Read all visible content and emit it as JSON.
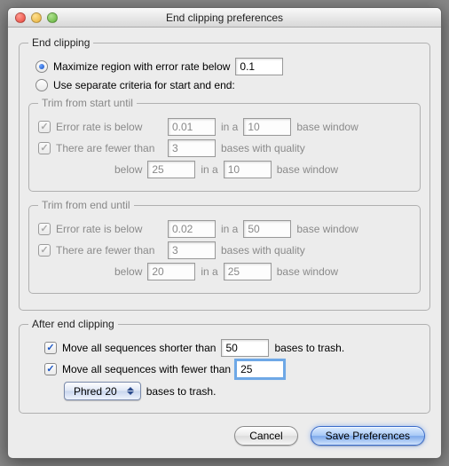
{
  "window": {
    "title": "End clipping preferences"
  },
  "groups": {
    "endClipping": "End clipping",
    "trimStart": "Trim from start until",
    "trimEnd": "Trim from end until",
    "after": "After end clipping"
  },
  "radios": {
    "maximize": "Maximize region with error rate below",
    "separate": "Use separate criteria for start and end:"
  },
  "values": {
    "maxErrorRate": "0.1",
    "start_errRate": "0.01",
    "start_errWindow": "10",
    "start_fewerBases": "3",
    "start_qualBelow": "25",
    "start_qualWindow": "10",
    "end_errRate": "0.02",
    "end_errWindow": "50",
    "end_fewerBases": "3",
    "end_qualBelow": "20",
    "end_qualWindow": "25",
    "after_shorter": "50",
    "after_fewer": "25",
    "phred": "Phred 20"
  },
  "labels": {
    "errBelow": "Error rate is below",
    "inA": "in a",
    "baseWindow": "base window",
    "fewerThan": "There are fewer than",
    "basesQuality": "bases with quality",
    "below": "below",
    "moveShorter": "Move all sequences shorter than",
    "basesTrash": "bases to trash.",
    "moveFewer": "Move all sequences with fewer than"
  },
  "buttons": {
    "cancel": "Cancel",
    "save": "Save Preferences"
  }
}
